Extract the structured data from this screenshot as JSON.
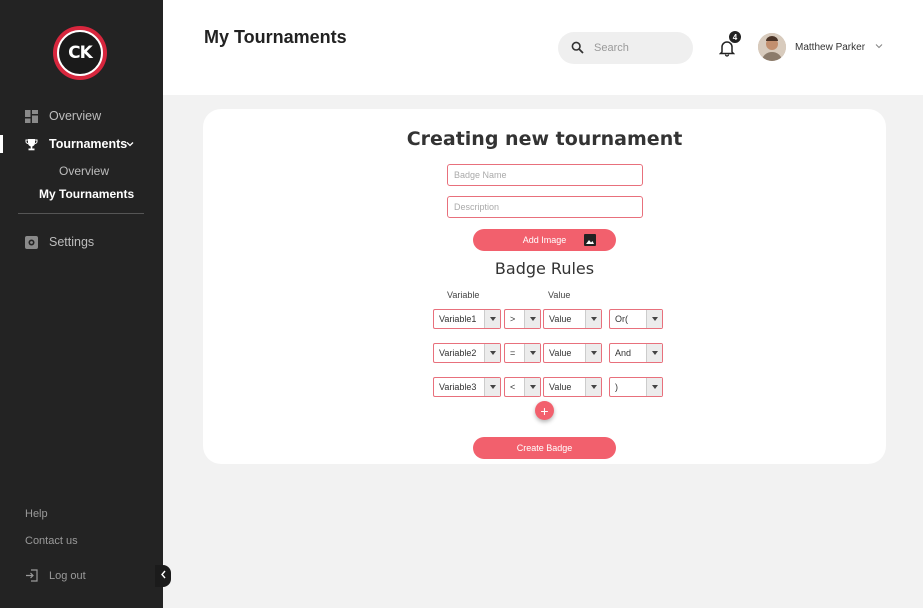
{
  "brand": {
    "logo_text": "CK"
  },
  "sidebar": {
    "items": [
      {
        "label": "Overview",
        "icon": "dashboard-icon"
      },
      {
        "label": "Tournaments",
        "icon": "trophy-icon"
      },
      {
        "label": "Settings",
        "icon": "settings-icon"
      }
    ],
    "sub_items": [
      {
        "label": "Overview"
      },
      {
        "label": "My Tournaments"
      }
    ],
    "help": "Help",
    "contact": "Contact us",
    "logout": "Log out"
  },
  "header": {
    "title": "My Tournaments",
    "search_placeholder": "Search",
    "notification_count": "4",
    "user_name": "Matthew Parker"
  },
  "form": {
    "title": "Creating new tournament",
    "badge_name_placeholder": "Badge Name",
    "description_placeholder": "Description",
    "add_image_label": "Add Image",
    "rules_title": "Badge Rules",
    "col_variable": "Variable",
    "col_value": "Value",
    "rules": [
      {
        "variable": "Variable1",
        "operator": ">",
        "value": "Value",
        "logic": "Or("
      },
      {
        "variable": "Variable2",
        "operator": "=",
        "value": "Value",
        "logic": "And"
      },
      {
        "variable": "Variable3",
        "operator": "<",
        "value": "Value",
        "logic": ")"
      }
    ],
    "add_rule_label": "+",
    "create_label": "Create Badge"
  },
  "colors": {
    "accent": "#f2606d",
    "sidebar_bg": "#232323",
    "field_border": "#e8707c"
  }
}
